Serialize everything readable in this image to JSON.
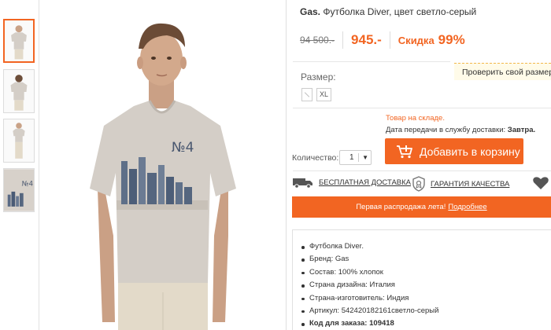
{
  "product": {
    "brand": "Gas.",
    "title": "Футболка Diver, цвет светло-серый"
  },
  "price": {
    "old": "94 500.-",
    "new": "945.-",
    "discount_label": "Скидка",
    "discount_value": "99%"
  },
  "size": {
    "label": "Размер:",
    "check_link": "Проверить свой размер",
    "options": [
      "XL"
    ]
  },
  "availability": {
    "stock": "Товар на складе.",
    "delivery_label": "Дата передачи в службу доставки:",
    "delivery_value": "Завтра."
  },
  "quantity": {
    "label": "Количество:",
    "value": "1"
  },
  "cart": {
    "add_label": "Добавить в корзину"
  },
  "features": {
    "free_delivery": "БЕСПЛАТНАЯ ДОСТАВКА",
    "quality": "ГАРАНТИЯ КАЧЕСТВА"
  },
  "promo": {
    "text": "Первая распродажа лета!",
    "link": "Подробнее"
  },
  "specs": [
    "Футболка Diver.",
    "Бренд: Gas",
    "Состав: 100% хлопок",
    "Страна дизайна: Италия",
    "Страна-изготовитель: Индия",
    "Артикул: 542420182161светло-серый"
  ],
  "order_code": {
    "label": "Код для заказа:",
    "value": "109418"
  },
  "shirt_print": "№4",
  "colors": {
    "accent": "#f26522",
    "shirt": "#d4cec7",
    "pants": "#e3dac9"
  }
}
